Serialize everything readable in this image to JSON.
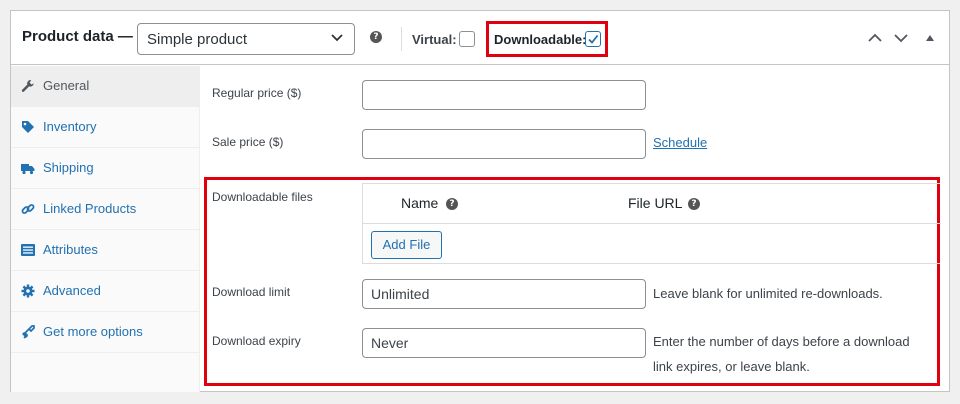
{
  "header": {
    "title": "Product data —",
    "product_type": "Simple product",
    "help_mark": "?",
    "virtual_label": "Virtual:",
    "downloadable_label": "Downloadable:",
    "virtual_checked": false,
    "downloadable_checked": true
  },
  "sidebar": {
    "items": [
      {
        "label": "General",
        "icon": "wrench-icon",
        "active": true
      },
      {
        "label": "Inventory",
        "icon": "tag-icon"
      },
      {
        "label": "Shipping",
        "icon": "truck-icon"
      },
      {
        "label": "Linked Products",
        "icon": "link-icon"
      },
      {
        "label": "Attributes",
        "icon": "list-icon"
      },
      {
        "label": "Advanced",
        "icon": "gear-icon"
      },
      {
        "label": "Get more options",
        "icon": "plugin-icon"
      }
    ]
  },
  "general": {
    "regular_price_label": "Regular price ($)",
    "regular_price_value": "",
    "sale_price_label": "Sale price ($)",
    "sale_price_value": "",
    "schedule_link": "Schedule",
    "downloadable_files_label": "Downloadable files",
    "files_table": {
      "col_name": "Name",
      "col_url": "File URL",
      "add_file_button": "Add File"
    },
    "download_limit_label": "Download limit",
    "download_limit_placeholder": "Unlimited",
    "download_limit_desc": "Leave blank for unlimited re-downloads.",
    "download_expiry_label": "Download expiry",
    "download_expiry_placeholder": "Never",
    "download_expiry_desc_line1": "Enter the number of days before a download",
    "download_expiry_desc_line2": "link expires, or leave blank."
  },
  "colors": {
    "accent": "#2271b1",
    "highlight": "#e1000f",
    "border": "#c3c4c7"
  }
}
